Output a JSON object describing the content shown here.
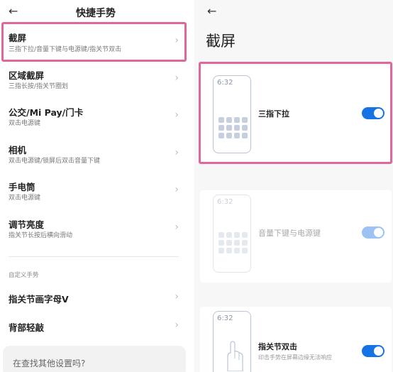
{
  "left": {
    "title": "快捷手势",
    "items": [
      {
        "title": "截屏",
        "subtitle": "三指下拉/音量下键与电源键/指关节双击"
      },
      {
        "title": "区域截屏",
        "subtitle": "三指长按/指关节圈划"
      },
      {
        "title": "公交/Mi Pay/门卡",
        "subtitle": "双击电源键"
      },
      {
        "title": "相机",
        "subtitle": "双击电源键/锁屏后双击音量下键"
      },
      {
        "title": "手电筒",
        "subtitle": "双击电源键"
      },
      {
        "title": "调节亮度",
        "subtitle": "指关节长按后横向滑动"
      }
    ],
    "custom_section_label": "自定义手势",
    "custom_items": [
      {
        "title": "指关节画字母V"
      },
      {
        "title": "背部轻敲"
      }
    ],
    "search_prompt": "在查找其他设置吗?"
  },
  "right": {
    "title": "截屏",
    "options": [
      {
        "label": "三指下拉",
        "phone_time": "6:32",
        "enabled": true,
        "active": true
      },
      {
        "label": "音量下键与电源键",
        "phone_time": "6:32",
        "enabled": true,
        "active": false
      },
      {
        "label": "指关节双击",
        "subtitle": "印击手势在屏幕边缘无法响应",
        "phone_time": "6:32",
        "enabled": true,
        "active": true
      }
    ]
  },
  "icons": {
    "back": "arrow-left-icon",
    "chevron": "chevron-right-icon"
  },
  "colors": {
    "highlight": "#e0679a",
    "toggle_on": "#1772e6",
    "toggle_disabled": "#9dc2f4"
  }
}
